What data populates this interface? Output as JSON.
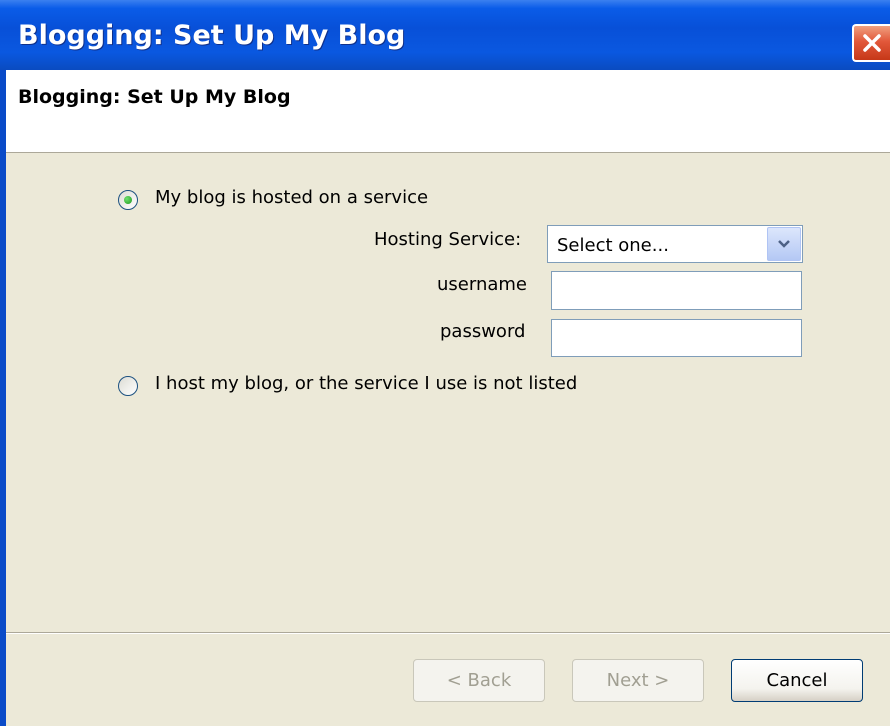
{
  "window": {
    "title": "Blogging: Set Up My Blog"
  },
  "header": {
    "title": "Blogging: Set Up My Blog"
  },
  "form": {
    "option_hosted_label": "My blog is hosted on a service",
    "option_hosted_selected": true,
    "hosting_service_label": "Hosting Service:",
    "hosting_service_value": "Select one...",
    "username_label": "username",
    "username_value": "",
    "password_label": "password",
    "password_value": "",
    "option_selfhost_label": "I host my blog, or the service I use is not listed",
    "option_selfhost_selected": false
  },
  "footer": {
    "back_label": "< Back",
    "next_label": "Next >",
    "cancel_label": "Cancel"
  },
  "colors": {
    "title_bar": "#0a5ce8",
    "dialog_bg": "#ece9d8",
    "close_button": "#e2583a"
  }
}
